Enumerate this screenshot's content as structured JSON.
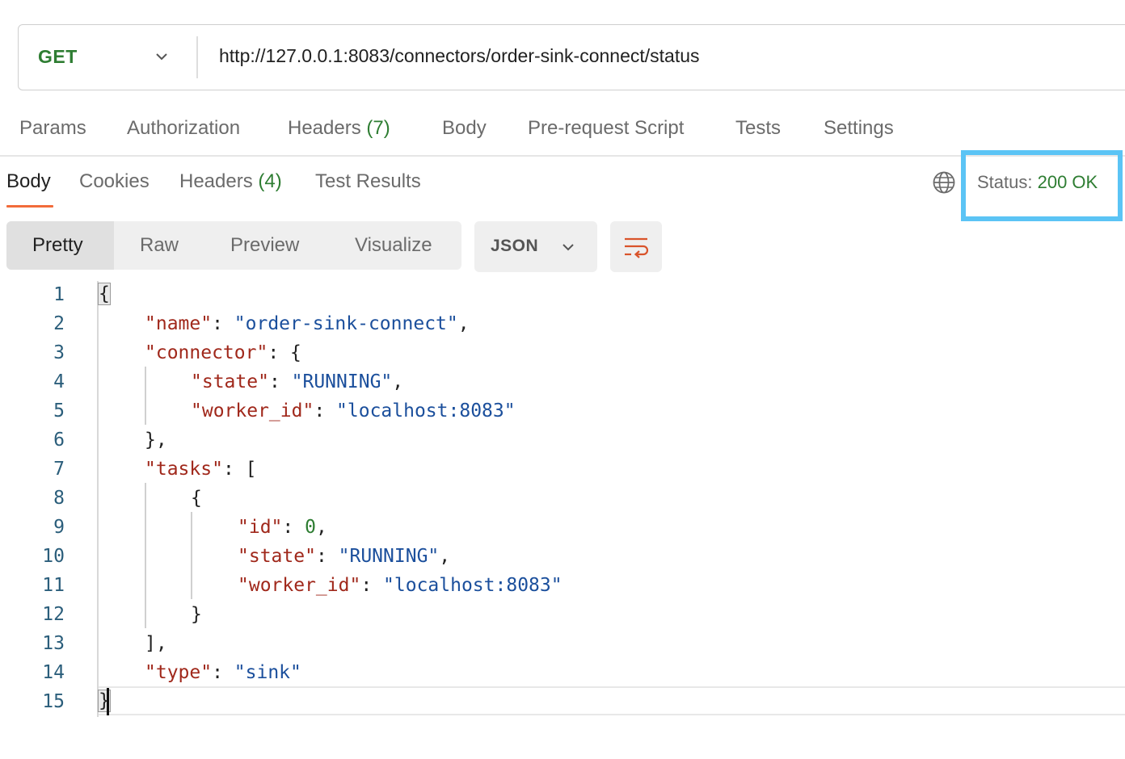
{
  "request": {
    "method": "GET",
    "url": "http://127.0.0.1:8083/connectors/order-sink-connect/status"
  },
  "request_tabs": {
    "params": "Params",
    "authorization": "Authorization",
    "headers": "Headers",
    "headers_count": "(7)",
    "body": "Body",
    "prerequest": "Pre-request Script",
    "tests": "Tests",
    "settings": "Settings"
  },
  "response_tabs": {
    "body": "Body",
    "cookies": "Cookies",
    "headers": "Headers",
    "headers_count": "(4)",
    "test_results": "Test Results"
  },
  "status": {
    "label": "Status:",
    "value": "200 OK"
  },
  "format_tabs": {
    "pretty": "Pretty",
    "raw": "Raw",
    "preview": "Preview",
    "visualize": "Visualize"
  },
  "format_select": "JSON",
  "icons": {
    "method_dropdown": "chevron-down-icon",
    "globe": "globe-icon",
    "format_dropdown": "chevron-down-icon",
    "wrap": "wrap-lines-icon"
  },
  "colors": {
    "accent_orange": "#f26b3a",
    "status_green": "#2e7d32",
    "highlight_blue": "#5bc4f5",
    "json_key": "#a0281b",
    "json_string": "#1b4f9c",
    "json_number": "#2e7d32"
  },
  "code": {
    "line_numbers": [
      "1",
      "2",
      "3",
      "4",
      "5",
      "6",
      "7",
      "8",
      "9",
      "10",
      "11",
      "12",
      "13",
      "14",
      "15"
    ],
    "l1_open": "{",
    "l2_key": "\"name\"",
    "l2_colon": ": ",
    "l2_val": "\"order-sink-connect\"",
    "l2_comma": ",",
    "l3_key": "\"connector\"",
    "l3_rest": ": {",
    "l4_key": "\"state\"",
    "l4_colon": ": ",
    "l4_val": "\"RUNNING\"",
    "l4_comma": ",",
    "l5_key": "\"worker_id\"",
    "l5_colon": ": ",
    "l5_val": "\"localhost:8083\"",
    "l6": "},",
    "l7_key": "\"tasks\"",
    "l7_rest": ": [",
    "l8": "{",
    "l9_key": "\"id\"",
    "l9_colon": ": ",
    "l9_val": "0",
    "l9_comma": ",",
    "l10_key": "\"state\"",
    "l10_colon": ": ",
    "l10_val": "\"RUNNING\"",
    "l10_comma": ",",
    "l11_key": "\"worker_id\"",
    "l11_colon": ": ",
    "l11_val": "\"localhost:8083\"",
    "l12": "}",
    "l13": "],",
    "l14_key": "\"type\"",
    "l14_colon": ": ",
    "l14_val": "\"sink\"",
    "l15_close": "}"
  }
}
